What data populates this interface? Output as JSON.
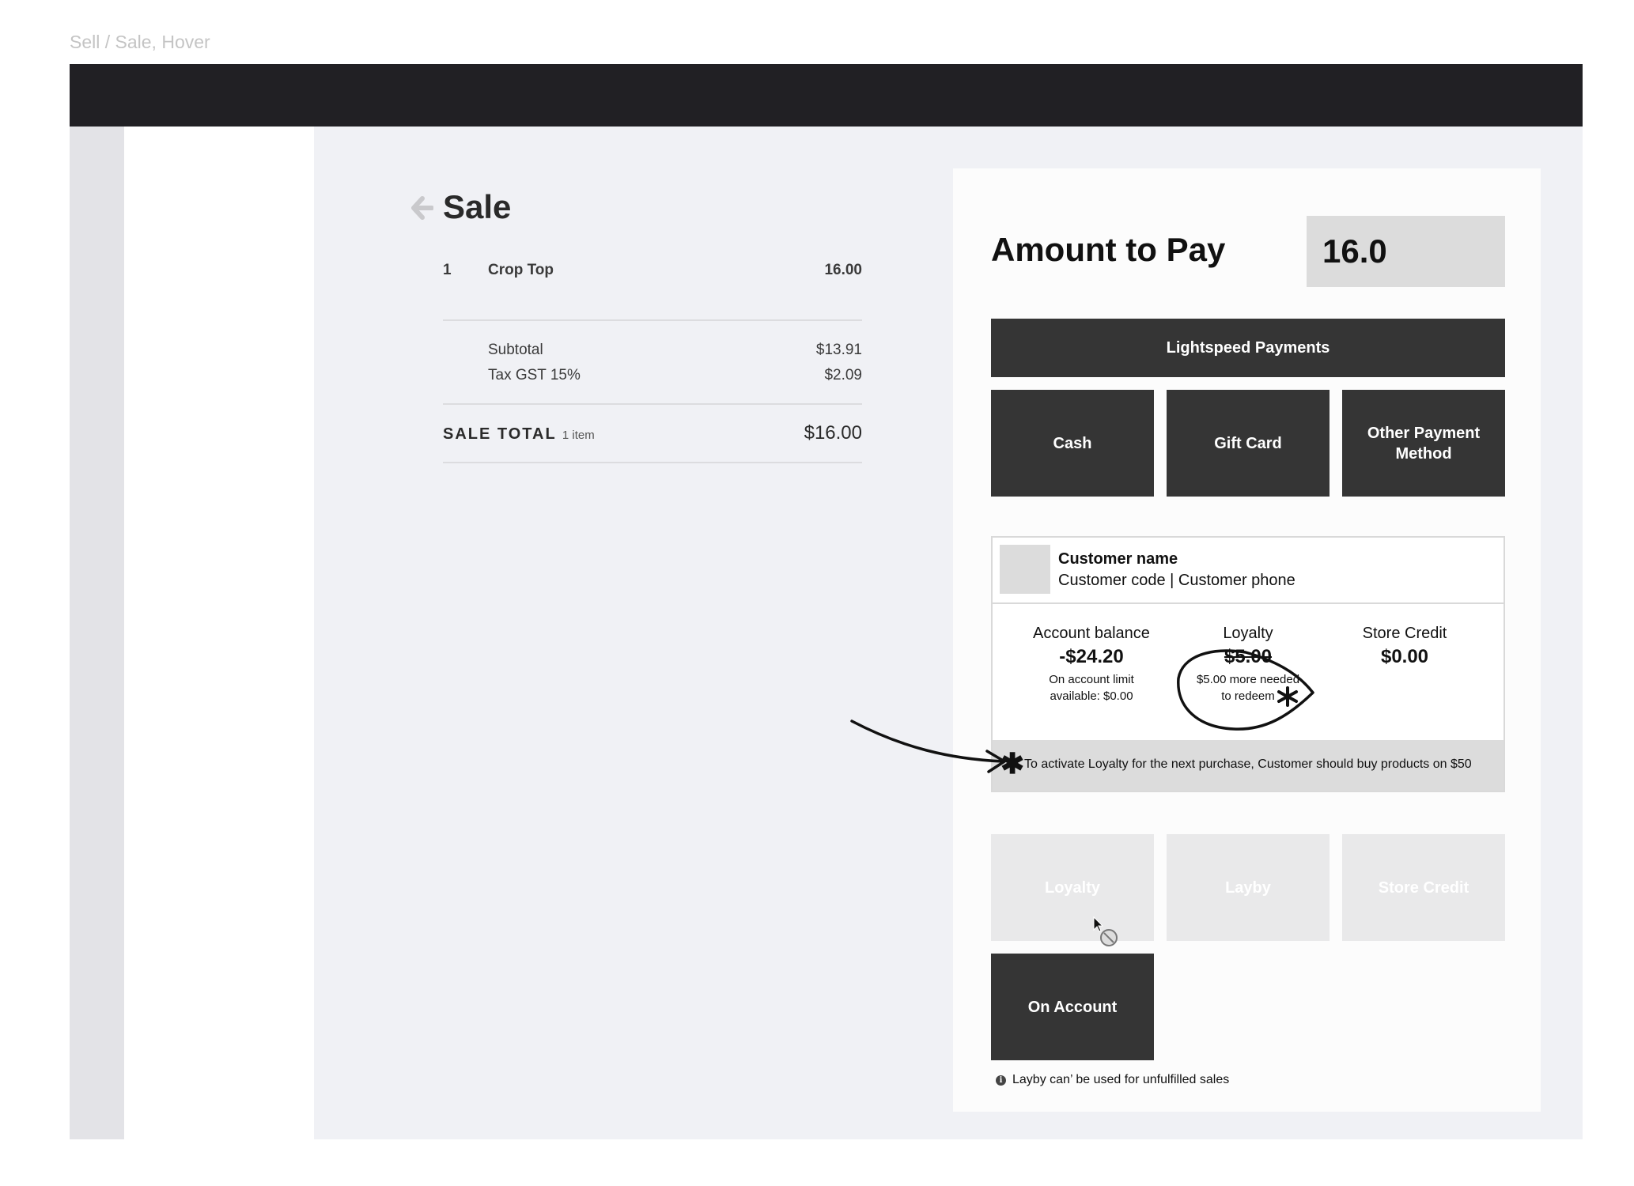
{
  "frame_label": "Sell / Sale, Hover",
  "sale": {
    "title": "Sale",
    "items": [
      {
        "qty": "1",
        "name": "Crop Top",
        "price": "16.00"
      }
    ],
    "subtotal_label": "Subtotal",
    "subtotal_value": "$13.91",
    "tax_label": "Tax GST 15%",
    "tax_value": "$2.09",
    "total_label": "SALE TOTAL",
    "total_count": "1 item",
    "total_value": "$16.00"
  },
  "payment": {
    "title": "Amount to Pay",
    "amount": "16.0",
    "lightspeed_label": "Lightspeed Payments",
    "cash_label": "Cash",
    "gift_card_label": "Gift Card",
    "other_label": "Other Payment Method",
    "loyalty_label": "Loyalty",
    "layby_label": "Layby",
    "store_credit_label": "Store Credit",
    "on_account_label": "On Account",
    "info_note": "Layby can’ be used for unfulfilled sales"
  },
  "customer": {
    "name": "Customer name",
    "sub": "Customer code | Customer phone",
    "account_balance_label": "Account balance",
    "account_balance_value": "-$24.20",
    "account_limit_note_1": "On account limit",
    "account_limit_note_2": "available: $0.00",
    "loyalty_label": "Loyalty",
    "loyalty_value": "$5.00",
    "loyalty_note_1": "$5.00 more needed",
    "loyalty_note_2": "to redeem",
    "store_credit_label": "Store Credit",
    "store_credit_value": "$0.00",
    "banner_asterisk": "✱",
    "banner_text": "To activate Loyalty for the next purchase, Customer should buy products on $50"
  },
  "colors": {
    "topbar": "#212024",
    "button_dark": "#353535",
    "button_disabled": "#e9e9ea",
    "canvas": "#f0f1f5"
  }
}
